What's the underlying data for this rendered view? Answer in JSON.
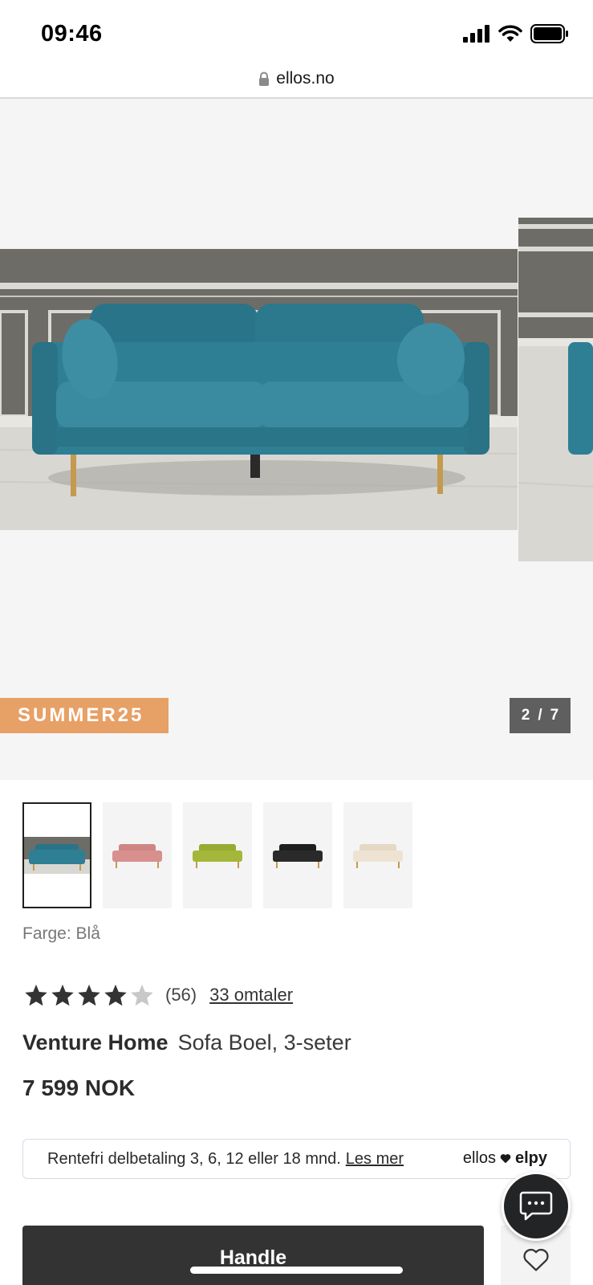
{
  "status_bar": {
    "time": "09:46",
    "icons": [
      "signal-icon",
      "wifi-icon",
      "battery-icon"
    ]
  },
  "browser": {
    "url": "ellos.no",
    "icons": [
      "lock-icon"
    ]
  },
  "gallery": {
    "promo_code": "SUMMER25",
    "counter_current": "2",
    "counter_separator": "/",
    "counter_total": "7",
    "sofa_colors": {
      "main": "#2f7f94",
      "wall": "#6e6c67",
      "floor": "#d9d7d2",
      "legs": "#c39a4e"
    }
  },
  "color_options": {
    "items": [
      {
        "name": "Blå",
        "color": "#2f7f94"
      },
      {
        "name": "Rosa",
        "color": "#d8908e"
      },
      {
        "name": "Grønn",
        "color": "#a4b73a"
      },
      {
        "name": "Svart",
        "color": "#2a2a2a"
      },
      {
        "name": "Beige",
        "color": "#eee3d2"
      }
    ],
    "selected_index": 0,
    "label": "Farge: Blå"
  },
  "rating": {
    "stars_filled": 4,
    "stars_total": 5,
    "count": "(56)",
    "reviews_link": "33 omtaler"
  },
  "product": {
    "brand": "Venture Home",
    "name": "Sofa Boel, 3-seter",
    "price": "7 599 NOK"
  },
  "financing": {
    "text": "Rentefri delbetaling 3, 6, 12 eller 18 mnd.",
    "link": "Les mer",
    "logo_ellos": "ellos",
    "logo_elpy": "elpy"
  },
  "actions": {
    "buy_label": "Handle",
    "icons": [
      "chat-icon",
      "heart-icon"
    ]
  },
  "colors": {
    "promo": "#e7a066",
    "counter": "#5f5f5f",
    "button": "#333333"
  }
}
